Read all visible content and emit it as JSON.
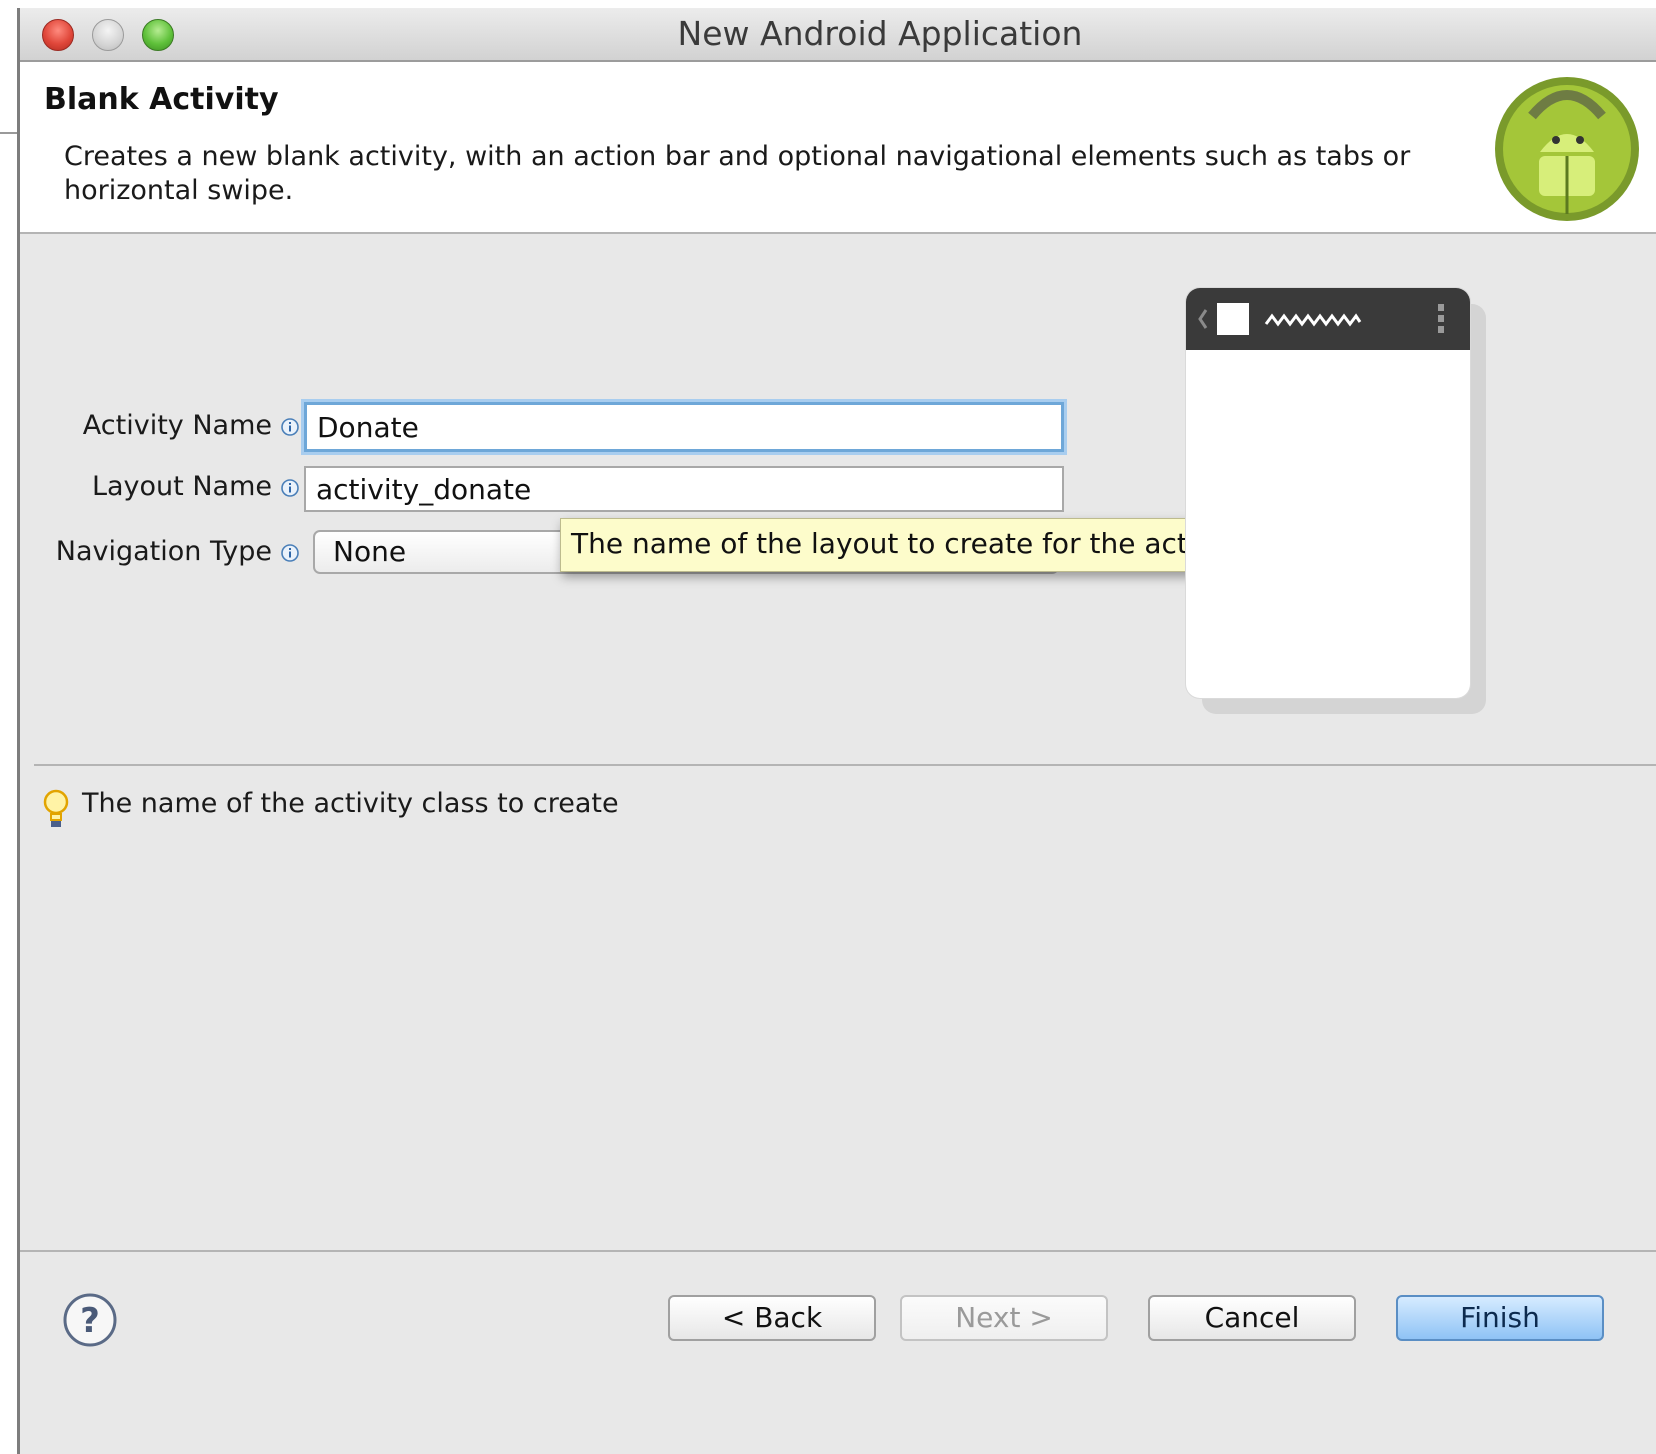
{
  "window": {
    "title": "New Android Application"
  },
  "header": {
    "title": "Blank Activity",
    "description": "Creates a new blank activity, with an action bar and optional navigational elements such as tabs or horizontal swipe."
  },
  "form": {
    "activity_name": {
      "label": "Activity Name",
      "value": "Donate"
    },
    "layout_name": {
      "label": "Layout Name",
      "value": "activity_donate"
    },
    "navigation_type": {
      "label": "Navigation Type",
      "selected": "None"
    }
  },
  "tooltip": {
    "text": "The name of the layout to create for the activity"
  },
  "hint": {
    "text": "The name of the activity class to create"
  },
  "buttons": {
    "back": "< Back",
    "next": "Next >",
    "cancel": "Cancel",
    "finish": "Finish"
  },
  "colors": {
    "dialog_background": "#e8e8e8",
    "focus_ring": "#6ea7d8",
    "tooltip_background": "#fdfccb",
    "primary_button": "#8fc3f5",
    "android_green": "#a4c639"
  },
  "icons": {
    "close": "close-icon",
    "minimize": "minimize-icon",
    "zoom": "zoom-icon",
    "android_logo": "android-logo-icon",
    "info": "info-icon",
    "hint": "lightbulb-icon",
    "help": "help-icon"
  }
}
